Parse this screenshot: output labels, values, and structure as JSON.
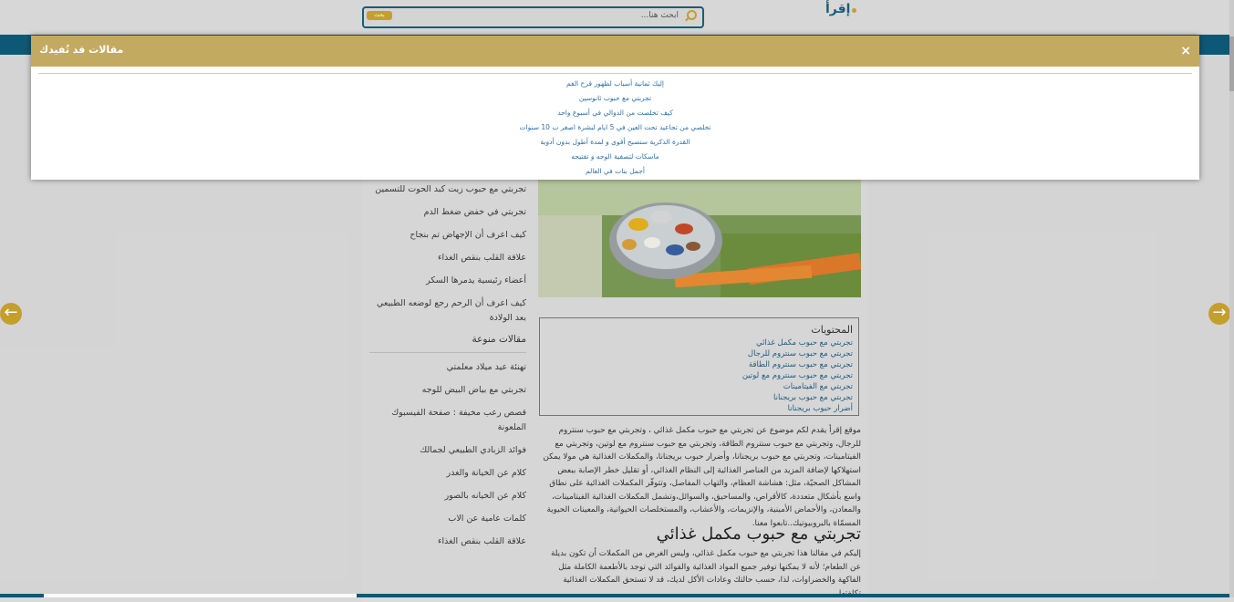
{
  "header": {
    "logo_text": "إقرأ",
    "search_placeholder": "ابحث هنا...",
    "search_button": "بحث"
  },
  "sidebar": {
    "top_items": [
      "تجربتي مع حبوب زيت كبد الحوت للتسمين",
      "تجربتي في خفض ضغط الدم",
      "كيف اعرف أن الإجهاض تم بنجاح",
      "علاقة القلب بنقص الغذاء",
      "أعضاء رئيسية يدمرها السكر",
      "كيف اعرف أن الرحم رجع لوضعه الطبيعي بعد الولادة"
    ],
    "section_heading": "مقالات منوعة",
    "bottom_items": [
      "تهنئة عيد ميلاد معلمتي",
      "تجربتي مع بياض البيض للوجه",
      "قصص رعب مخيفة : صفحة الفيسبوك الملعونة",
      "فوائد الزبادي الطبيعي لجمالك",
      "كلام عن الخيانة والغدر",
      "كلام عن الخيانه بالصور",
      "كلمات عامية عن الاب",
      "علاقة القلب بنقص الغذاء"
    ]
  },
  "toc": {
    "title": "المحتويات",
    "links": [
      "تجربتي مع حبوب مكمل غذائي",
      "تجربتي مع حبوب سنتروم للرجال",
      "تجربتي مع حبوب سنتروم الطاقة",
      "تجربتي مع حبوب سنتروم مع لوتين",
      "تجربتي مع الفيتامينات",
      "تجربتي مع حبوب بريجنانا",
      "أضرار حبوب بريجنانا"
    ]
  },
  "article": {
    "intro": "موقع إقرأ يقدم لكم موضوع عن تجربتي مع حبوب مكمل غذائي ، وتجربتي مع حبوب سنتروم للرجال، وتجربتي مع حبوب سنتروم الطاقة، وتجربتي مع حبوب سنتروم مع لوتين، وتجربتي مع الفيتامينات، وتجربتي مع حبوب بريجنانا، وأضرار حبوب بريجنانا، والمكملات الغذائية هي مولا يمكن استهلاكها لإضافة المزيد من العناصر الغذائية إلى النظام الغذائي، أو تقليل خطر الإصابة ببعض المشاكل الصحيّة، مثل: هشاشة العظام، والتهاب المفاصل، وتتوفّر المكملات الغذائية على نطاق واسع بأشكال متعددة، كالأقراص، والمساحيق، والسوائل،وتشمل المكملات الغذائية الفيتامينات، والمعادن، والأحماض الأمينية، والإنزيمات، والأعشاب، والمستخلصات الحيوانية، والمعينات الحيوية المسمّاة بالبروبيوتيك..تابعوا معنا.",
    "h2": "تجربتي مع حبوب مكمل غذائي",
    "para2": "إليكم في مقالنا هذا تجربتي مع حبوب مكمل غذائي، وليس الغرض من المكملات أن تكون بديلة عن الطعام؛ لأنه لا يمكنها توفير جميع المواد الغذائية والفوائد التي توجد بالأطعمة الكاملة مثل الفاكهة والخضراوات، لذا، حسب حالتك وعادات الأكل لديك، قد لا تستحق المكملات الغذائية تكلفتها."
  },
  "modal": {
    "title": "مقالات قد تُفيدك",
    "close": "×",
    "links": [
      "إليك ثمانية أسباب لظهور قرح الفم",
      "تجربتي مع حبوب ثانوسين",
      "كيف تخلصت من الدوالي في أسبوع واحد",
      "تخلصي من تجاعيد تحت العين في 5 ايام لبشرة اصغر ب 10 سنوات",
      "القدرة الذكرية ستصبح أقوى و لمدة أطول بدون أدوية",
      "ماسكات لتصفية الوجه و تفتيحه",
      "أجمل بنات في العالم"
    ]
  },
  "colors": {
    "accent": "#c8a32e",
    "nav": "#0f5a7a",
    "modal_header": "#c3aa61",
    "link": "#2a70a8"
  }
}
